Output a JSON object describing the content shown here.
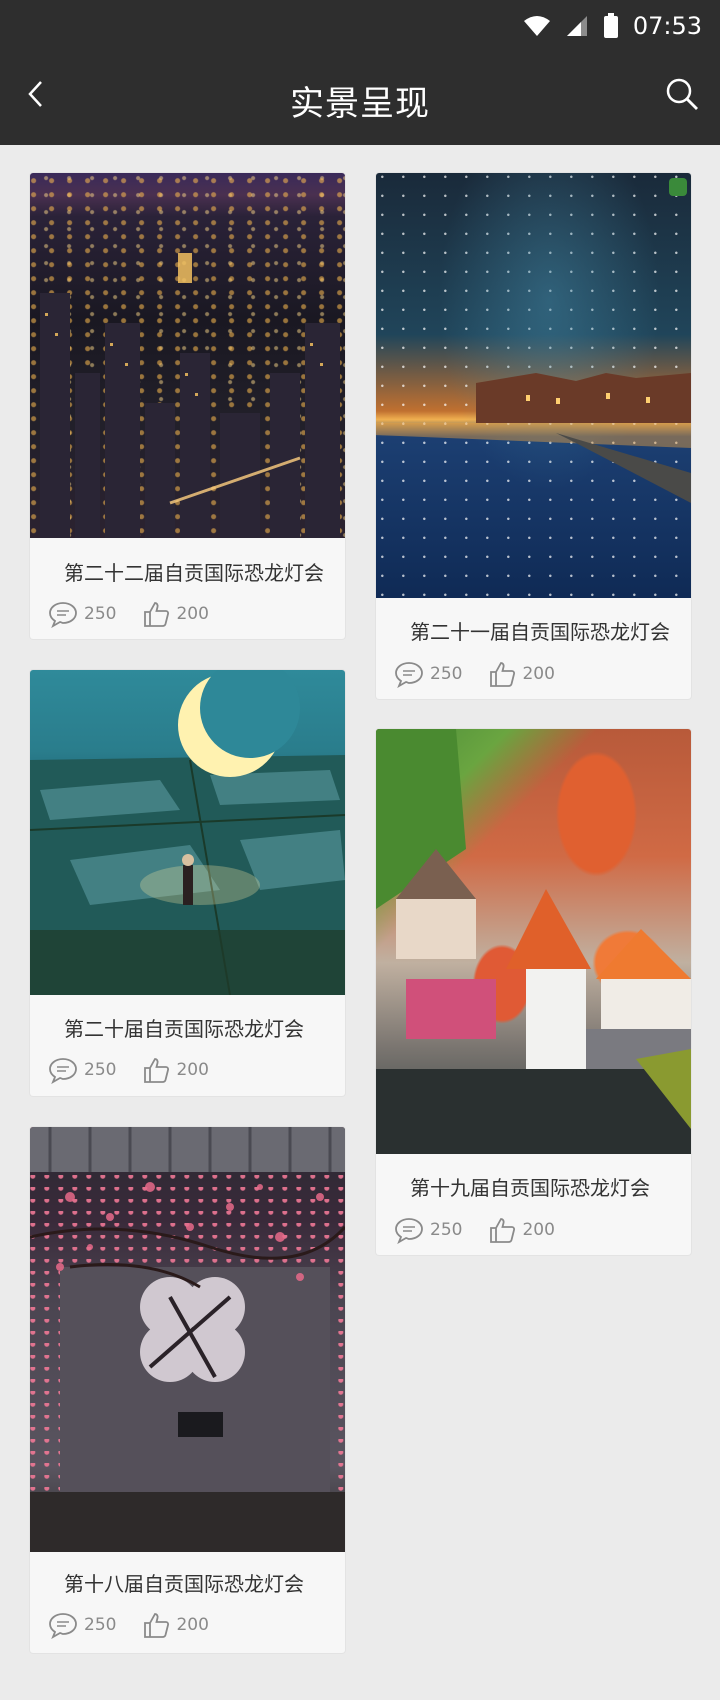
{
  "status_bar": {
    "time": "07:53"
  },
  "header": {
    "title": "实景呈现"
  },
  "cards": [
    {
      "caption": "第二十二届自贡国际恐龙灯会",
      "comments": "250",
      "likes": "200",
      "scene": "city-night"
    },
    {
      "caption": "第二十一届自贡国际恐龙灯会",
      "comments": "250",
      "likes": "200",
      "scene": "river-night"
    },
    {
      "caption": "第二十届自贡国际恐龙灯会",
      "comments": "250",
      "likes": "200",
      "scene": "moon-field"
    },
    {
      "caption": "第十九届自贡国际恐龙灯会",
      "comments": "250",
      "likes": "200",
      "scene": "colorful-town"
    },
    {
      "caption": "第十八届自贡国际恐龙灯会",
      "comments": "250",
      "likes": "200",
      "scene": "plum-window"
    }
  ],
  "colors": {
    "header_bg": "#2e2e2e",
    "page_bg": "#ebebeb",
    "card_bg": "#f7f7f7",
    "meta_text": "#8a8a8a"
  }
}
